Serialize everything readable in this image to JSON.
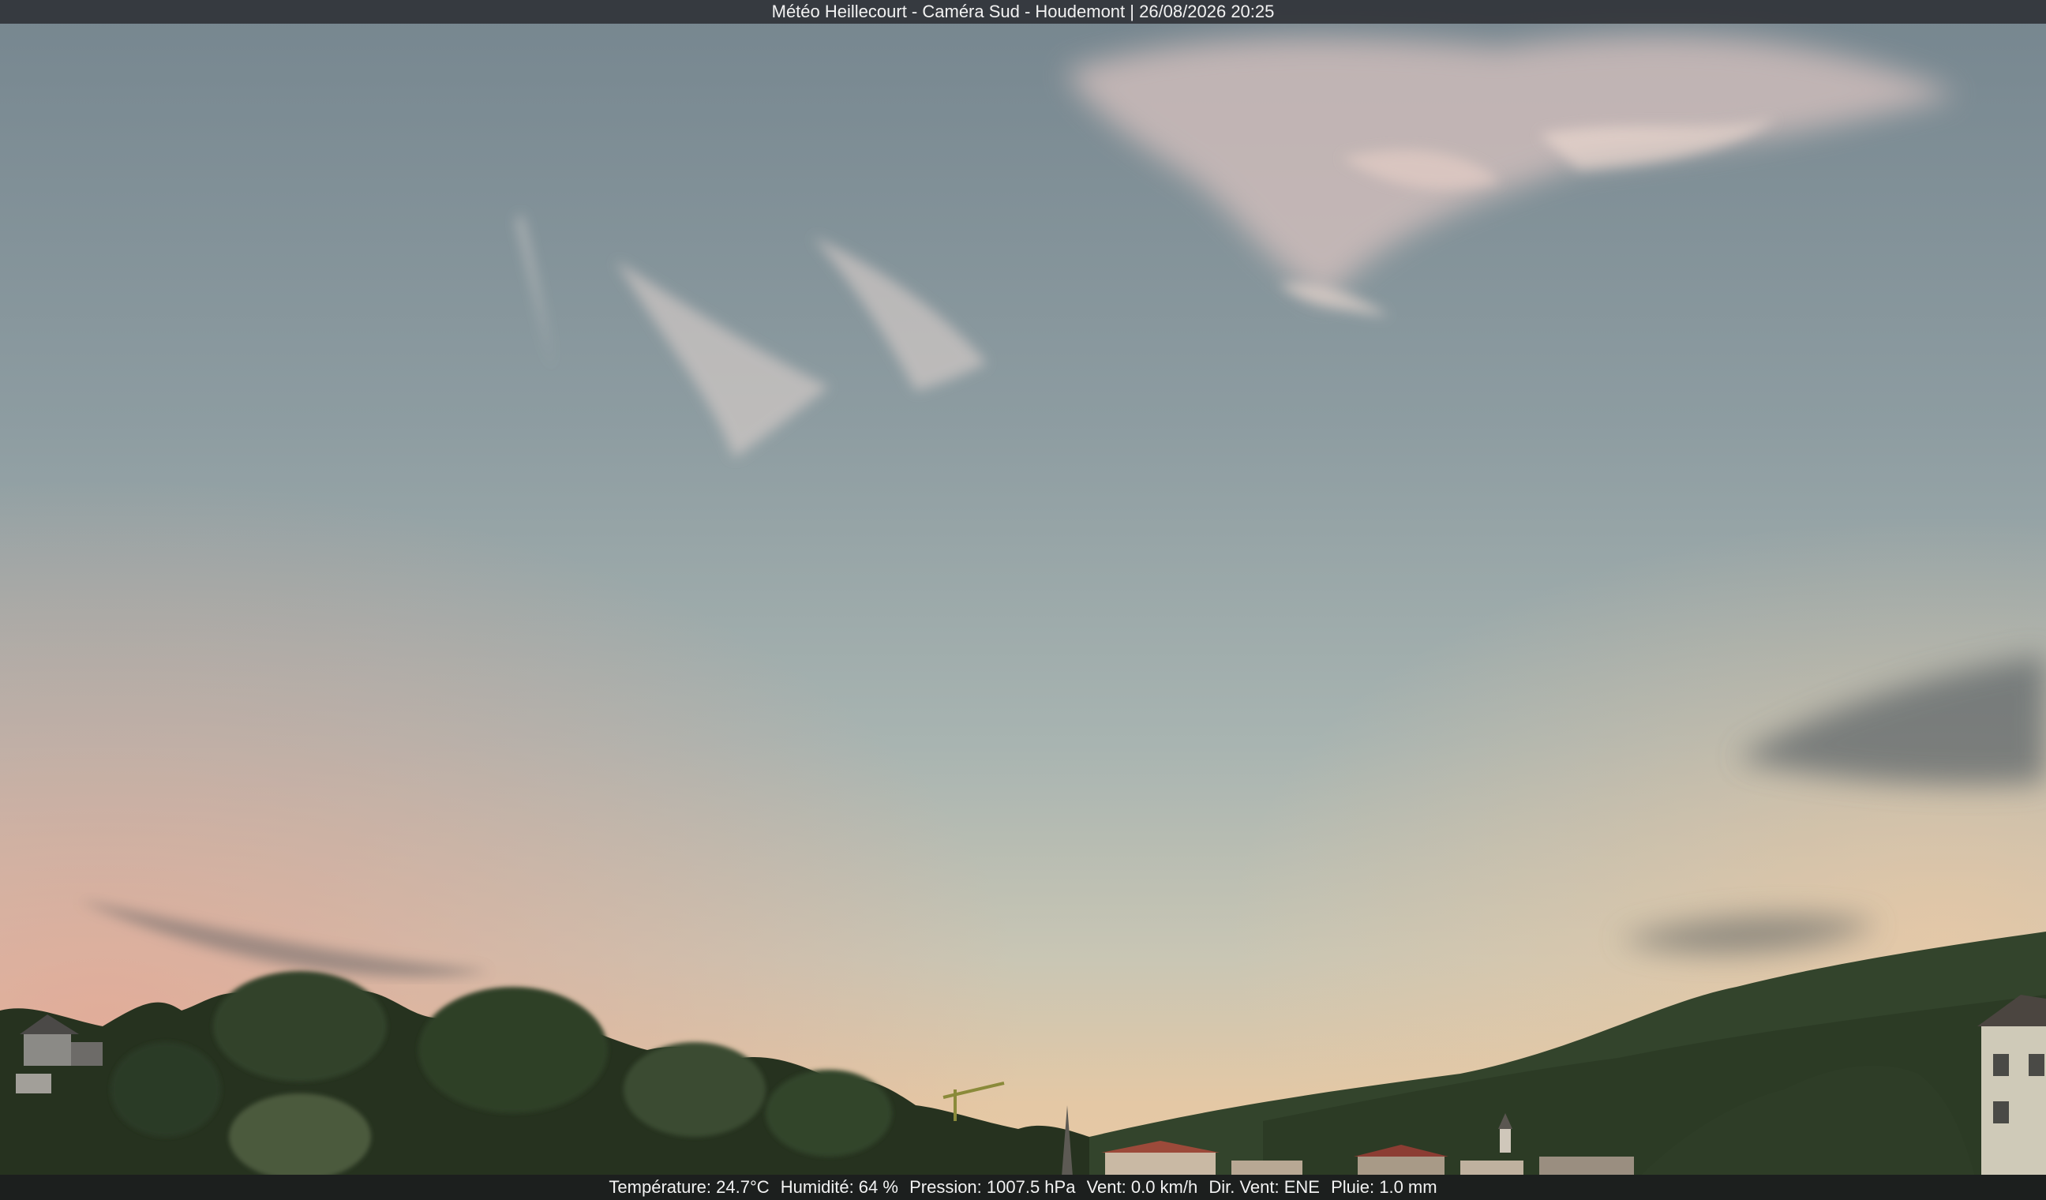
{
  "header": {
    "caption": "Météo Heillecourt - Caméra Sud - Houdemont | 26/08/2026 20:25"
  },
  "footer": {
    "temperature": "Température: 24.7°C",
    "humidity": "Humidité: 64 %",
    "pressure": "Pression: 1007.5 hPa",
    "wind_speed": "Vent: 0.0 km/h",
    "wind_direction": "Dir. Vent: ENE",
    "rain": "Pluie: 1.0 mm"
  },
  "colors": {
    "sky_top": "#7b8c96",
    "sky_mid": "#a9b5b4",
    "sky_horizon": "#e6c9a6",
    "horizon_pink": "#d9a89a",
    "trees_dark": "#1f2a1d",
    "trees_mid": "#34452c",
    "hill": "#2c3b27"
  }
}
